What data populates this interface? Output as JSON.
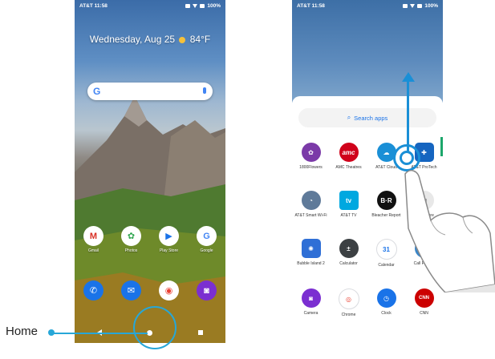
{
  "left_phone": {
    "status": {
      "carrier_time": "AT&T 11:58",
      "battery": "100%"
    },
    "date_weather": {
      "date": "Wednesday, Aug 25",
      "temp": "84°F"
    },
    "search": {
      "logo": "G"
    },
    "apps": [
      {
        "label": "Gmail",
        "glyph": "M",
        "color": "#ffffff",
        "fg": "#d93025"
      },
      {
        "label": "Photos",
        "glyph": "✿",
        "color": "#ffffff",
        "fg": "#34a853"
      },
      {
        "label": "Play Store",
        "glyph": "▶",
        "color": "#ffffff",
        "fg": "#1a73e8"
      },
      {
        "label": "Google",
        "glyph": "G",
        "color": "#ffffff",
        "fg": "#4285f4"
      }
    ],
    "dock": [
      {
        "glyph": "✆",
        "color": "#1a73e8"
      },
      {
        "glyph": "✉",
        "color": "#1a73e8"
      },
      {
        "glyph": "◉",
        "color": "#ffffff"
      },
      {
        "glyph": "◙",
        "color": "#7b2fd1"
      }
    ]
  },
  "right_phone": {
    "status": {
      "carrier_time": "AT&T 11:58",
      "battery": "100%"
    },
    "search_apps": {
      "label": "Search apps",
      "glyph": "⌕"
    },
    "rows": [
      [
        {
          "label": "1800Flowers",
          "glyph": "✿",
          "color": "#7b3aa8"
        },
        {
          "label": "AMC Theatres",
          "glyph": "amc",
          "color": "#d0021b"
        },
        {
          "label": "AT&T Cloud",
          "glyph": "☁",
          "color": "#1a8fd6"
        },
        {
          "label": "AT&T ProTech",
          "glyph": "✚",
          "color": "#1565c0"
        }
      ],
      [
        {
          "label": "AT&T Smart Wi-Fi",
          "glyph": "◔",
          "color": "#5f7a99"
        },
        {
          "label": "AT&T TV",
          "glyph": "tv",
          "color": "#00a8e0"
        },
        {
          "label": "Bleacher Report",
          "glyph": "B·R",
          "color": "#111111"
        },
        {
          "label": "Book Store",
          "glyph": "▤",
          "color": "#e8e8e8"
        }
      ],
      [
        {
          "label": "Bubble Island 2",
          "glyph": "✺",
          "color": "#2f6fd6"
        },
        {
          "label": "Calculator",
          "glyph": "±",
          "color": "#3c4043"
        },
        {
          "label": "Calendar",
          "glyph": "31",
          "color": "#1a73e8"
        },
        {
          "label": "Call Protect",
          "glyph": "✆",
          "color": "#3a86c8"
        }
      ],
      [
        {
          "label": "Camera",
          "glyph": "◙",
          "color": "#7b2fd1"
        },
        {
          "label": "Chrome",
          "glyph": "◎",
          "color": "#ea4335"
        },
        {
          "label": "Clock",
          "glyph": "◷",
          "color": "#1a73e8"
        },
        {
          "label": "CNN",
          "glyph": "CNN",
          "color": "#cc0000"
        }
      ]
    ]
  },
  "annotation": {
    "home_label": "Home",
    "accent": "#27a7d8",
    "swipe_accent": "#1a8fd6"
  }
}
